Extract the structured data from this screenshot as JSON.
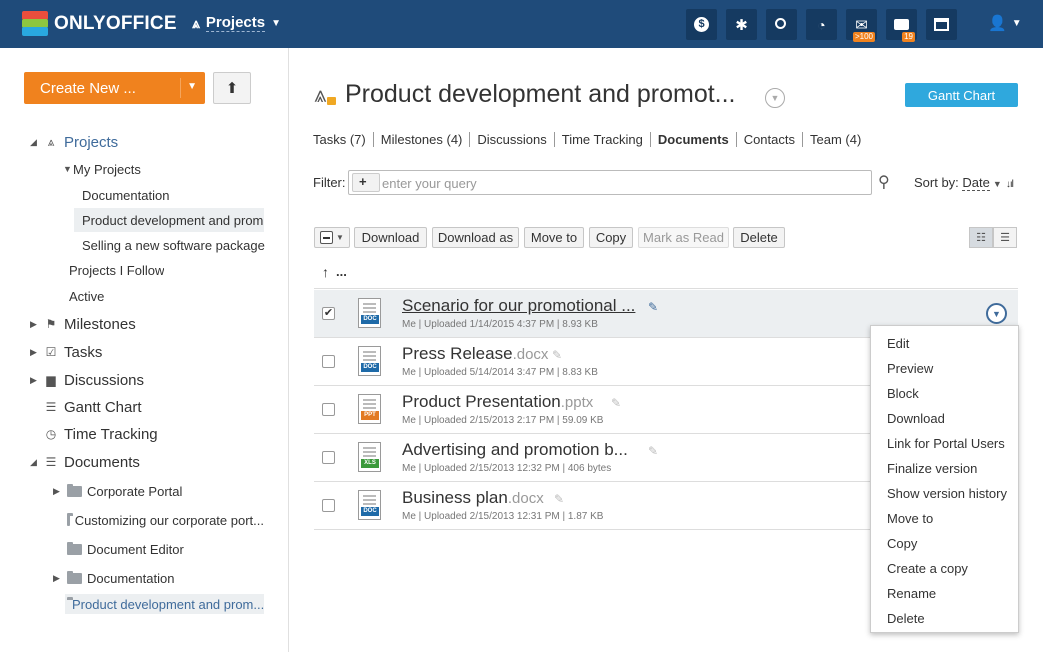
{
  "colors": {
    "topbar": "#1f4b7a",
    "accent_orange": "#f0821e",
    "gantt_blue": "#2fa8dd",
    "link_blue": "#3f6b9b",
    "doc_badge": "#1e6aa8",
    "ppt_badge": "#e27a22",
    "xls_badge": "#3c9a3c"
  },
  "header": {
    "logo_text": "ONLYOFFICE",
    "module_label": "Projects",
    "buttons": [
      {
        "name": "payments-icon",
        "glyph": "$"
      },
      {
        "name": "settings-icon",
        "glyph": "✱"
      },
      {
        "name": "search-icon",
        "glyph": "⚲"
      },
      {
        "name": "feed-icon",
        "glyph": "◠"
      },
      {
        "name": "mail-icon",
        "glyph": "✉",
        "badge": ">100"
      },
      {
        "name": "talk-icon",
        "glyph": "▬",
        "badge": "19"
      },
      {
        "name": "calendar-icon",
        "glyph": "▦"
      }
    ]
  },
  "sidebar": {
    "create_label": "Create New ...",
    "items": [
      {
        "label": "Projects"
      },
      {
        "label": "My Projects"
      },
      {
        "label": "Documentation"
      },
      {
        "label": "Product development and prom..."
      },
      {
        "label": "Selling a new software package"
      },
      {
        "label": "Projects I Follow"
      },
      {
        "label": "Active"
      },
      {
        "label": "Milestones"
      },
      {
        "label": "Tasks"
      },
      {
        "label": "Discussions"
      },
      {
        "label": "Gantt Chart"
      },
      {
        "label": "Time Tracking"
      },
      {
        "label": "Documents"
      },
      {
        "label": "Corporate Portal"
      },
      {
        "label": "Customizing our corporate port..."
      },
      {
        "label": "Document Editor"
      },
      {
        "label": "Documentation"
      },
      {
        "label": "Product development and prom..."
      }
    ]
  },
  "main": {
    "title": "Product development and promot...",
    "gantt_label": "Gantt Chart",
    "tabs": [
      {
        "label": "Tasks (7)"
      },
      {
        "label": "Milestones (4)"
      },
      {
        "label": "Discussions"
      },
      {
        "label": "Time Tracking"
      },
      {
        "label": "Documents"
      },
      {
        "label": "Contacts"
      },
      {
        "label": "Team (4)"
      }
    ],
    "filter": {
      "label": "Filter:",
      "placeholder": "enter your query",
      "plus": "+"
    },
    "sort": {
      "label": "Sort by:",
      "value": "Date"
    },
    "toolbar": {
      "download": "Download",
      "download_as": "Download as",
      "move_to": "Move to",
      "copy": "Copy",
      "mark_as_read": "Mark as Read",
      "delete": "Delete"
    },
    "up_label": "...",
    "files": [
      {
        "name": "Scenario for our promotional ...",
        "ext": "",
        "meta": "Me | Uploaded 1/14/2015 4:37 PM | 8.93 KB",
        "type": "DOC",
        "checked": true
      },
      {
        "name": "Press Release",
        "ext": ".docx",
        "meta": "Me | Uploaded 5/14/2014 3:47 PM | 8.83 KB",
        "type": "DOC",
        "checked": false
      },
      {
        "name": "Product Presentation",
        "ext": ".pptx",
        "meta": "Me | Uploaded 2/15/2013 2:17 PM | 59.09 KB",
        "type": "PPT",
        "checked": false
      },
      {
        "name": "Advertising and promotion b...",
        "ext": "",
        "meta": "Me | Uploaded 2/15/2013 12:32 PM | 406 bytes",
        "type": "XLS",
        "checked": false
      },
      {
        "name": "Business plan",
        "ext": ".docx",
        "meta": "Me | Uploaded 2/15/2013 12:31 PM | 1.87 KB",
        "type": "DOC",
        "checked": false
      }
    ]
  },
  "context_menu": {
    "items": [
      {
        "label": "Edit"
      },
      {
        "label": "Preview"
      },
      {
        "label": "Block"
      },
      {
        "label": "Download"
      },
      {
        "label": "Link for Portal Users"
      },
      {
        "label": "Finalize version"
      },
      {
        "label": "Show version history"
      },
      {
        "label": "Move to"
      },
      {
        "label": "Copy"
      },
      {
        "label": "Create a copy"
      },
      {
        "label": "Rename"
      },
      {
        "label": "Delete"
      }
    ]
  }
}
